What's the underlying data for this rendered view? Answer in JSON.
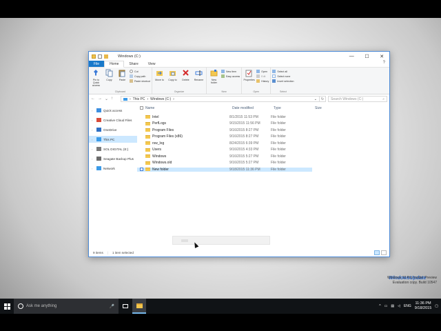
{
  "window": {
    "title": "Windows (C:)",
    "controls": {
      "minimize": "—",
      "maximize": "☐",
      "close": "✕"
    }
  },
  "tabs": [
    "File",
    "Home",
    "Share",
    "View"
  ],
  "ribbon": {
    "clipboard": {
      "pin": "Pin to Quick access",
      "copy": "Copy",
      "paste": "Paste",
      "cut": "Cut",
      "copy_path": "Copy path",
      "paste_shortcut": "Paste shortcut",
      "label": "Clipboard"
    },
    "organize": {
      "move_to": "Move to",
      "copy_to": "Copy to",
      "delete": "Delete",
      "rename": "Rename",
      "label": "Organize"
    },
    "new": {
      "new_folder": "New folder",
      "new_item": "New item",
      "easy_access": "Easy access",
      "label": "New"
    },
    "open": {
      "properties": "Properties",
      "open": "Open",
      "edit": "Edit",
      "history": "History",
      "label": "Open"
    },
    "select": {
      "select_all": "Select all",
      "select_none": "Select none",
      "invert": "Invert selection",
      "label": "Select"
    }
  },
  "address": {
    "path": [
      "This PC",
      "Windows (C:)"
    ],
    "search_placeholder": "Search Windows (C:)"
  },
  "nav": [
    {
      "label": "Quick access",
      "color": "#3d8fe0"
    },
    {
      "label": "Creative Cloud Files",
      "color": "#d94b3a"
    },
    {
      "label": "OneDrive",
      "color": "#2d6fc4"
    },
    {
      "label": "This PC",
      "color": "#3c9be8"
    },
    {
      "label": "SOL DIGITAL (E:)",
      "color": "#7a7a7a"
    },
    {
      "label": "Seagate Backup Plus",
      "color": "#6b6b6b"
    },
    {
      "label": "Network",
      "color": "#3c9be8"
    }
  ],
  "columns": {
    "name": "Name",
    "date": "Date modified",
    "type": "Type",
    "size": "Size"
  },
  "files": [
    {
      "name": "Intel",
      "date": "8/1/2015 11:53 PM",
      "type": "File folder"
    },
    {
      "name": "PerfLogs",
      "date": "9/15/2015 11:56 PM",
      "type": "File folder"
    },
    {
      "name": "Program Files",
      "date": "9/16/2015 8:27 PM",
      "type": "File folder"
    },
    {
      "name": "Program Files (x86)",
      "date": "9/16/2015 8:27 PM",
      "type": "File folder"
    },
    {
      "name": "rsw_log",
      "date": "8/24/2015 6:39 PM",
      "type": "File folder"
    },
    {
      "name": "Users",
      "date": "9/16/2015 4:33 PM",
      "type": "File folder"
    },
    {
      "name": "Windows",
      "date": "9/16/2015 5:27 PM",
      "type": "File folder"
    },
    {
      "name": "Windows.old",
      "date": "9/16/2015 5:27 PM",
      "type": "File folder"
    },
    {
      "name": "New folder",
      "date": "9/18/2015 11:36 PM",
      "type": "File folder"
    }
  ],
  "status": {
    "items": "9 items",
    "selected": "1 item selected"
  },
  "taskbar": {
    "search_placeholder": "Ask me anything",
    "lang": "ENG",
    "time": "11:36 PM",
    "date": "9/18/2015"
  },
  "watermark": {
    "logo": "WindowsUpdate",
    "line1": "Windows 10 Pro Insider Preview",
    "line2": "Evaluation copy. Build 10547"
  }
}
